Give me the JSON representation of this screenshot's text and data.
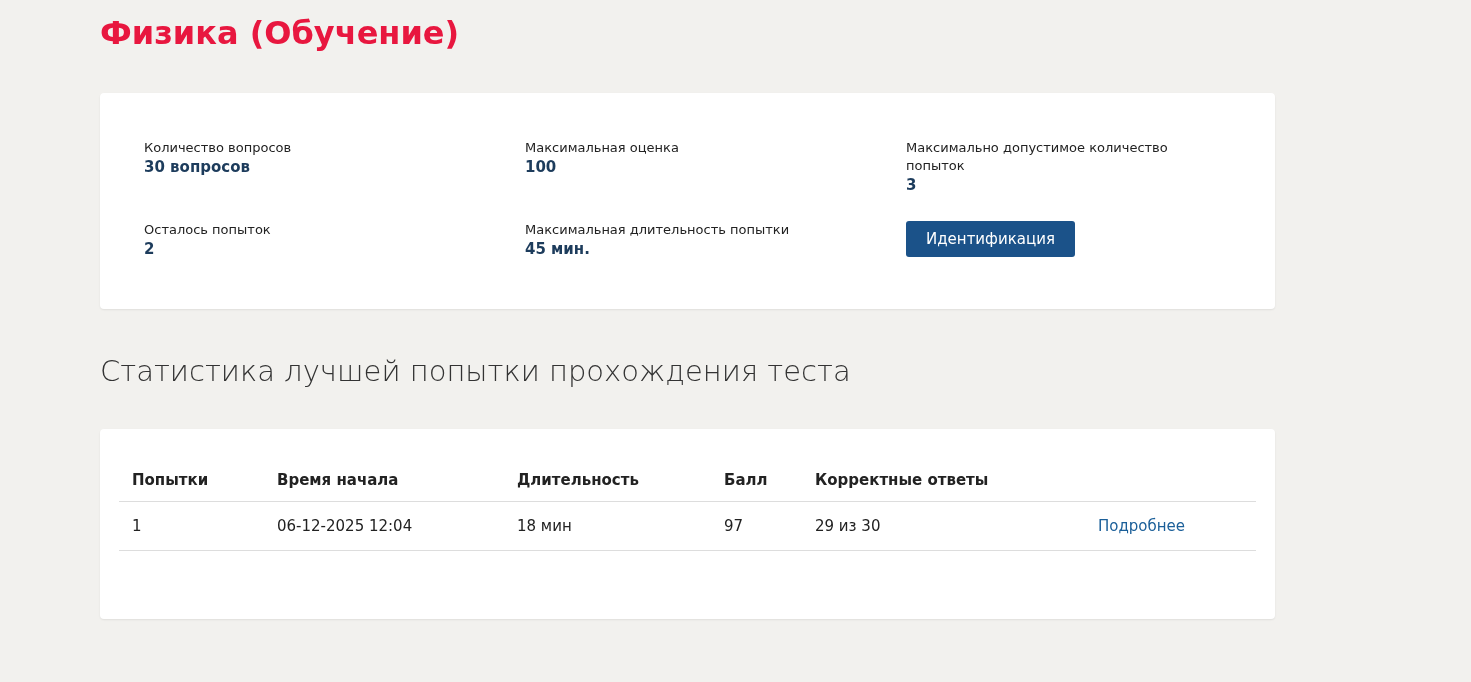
{
  "title": "Физика (Обучение)",
  "info": [
    {
      "kind": "stat",
      "label": "Количество вопросов",
      "value": "30 вопросов"
    },
    {
      "kind": "stat",
      "label": "Максимальная оценка",
      "value": "100"
    },
    {
      "kind": "stat",
      "label": "Максимально допустимое количество попыток",
      "value": "3"
    },
    {
      "kind": "stat",
      "label": "Осталось попыток",
      "value": "2"
    },
    {
      "kind": "stat",
      "label": "Максимальная длительность попытки",
      "value": "45 мин."
    },
    {
      "kind": "button",
      "label": "Идентификация"
    }
  ],
  "stats_heading": "Статистика лучшей попытки прохождения теста",
  "table": {
    "columns": [
      "Попытки",
      "Время начала",
      "Длительность",
      "Балл",
      "Корректные ответы"
    ],
    "rows": [
      {
        "cells": [
          "1",
          "06-12-2025 12:04",
          "18 мин",
          "97",
          "29 из 30"
        ],
        "link": "Подробнее"
      }
    ]
  }
}
